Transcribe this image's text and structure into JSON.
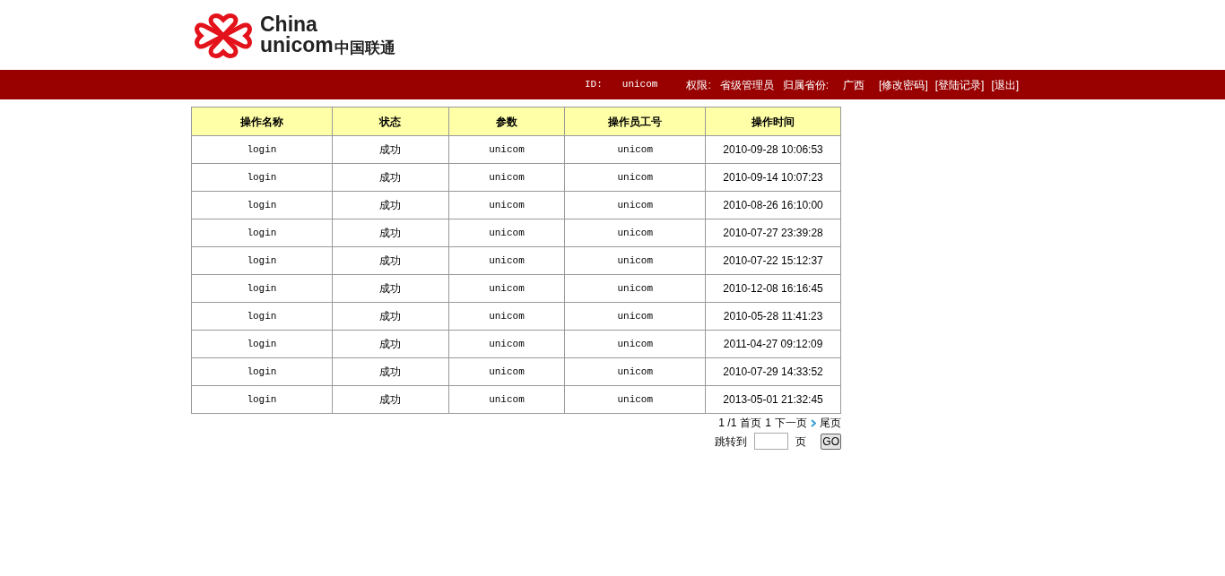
{
  "logo": {
    "line_1": "China",
    "line_2": "unicom",
    "line_3": "中国联通"
  },
  "topbar": {
    "id_label": "ID:",
    "id_value": "unicom",
    "role_label": "权限:",
    "role_value": "省级管理员",
    "province_label": "归属省份:",
    "province_value": "广西",
    "links": [
      "[修改密码]",
      "[登陆记录]",
      "[退出]"
    ]
  },
  "table": {
    "columns": [
      "操作名称",
      "状态",
      "参数",
      "操作员工号",
      "操作时间"
    ],
    "rows": [
      [
        "login",
        "成功",
        "unicom",
        "unicom",
        "2010-09-28 10:06:53"
      ],
      [
        "login",
        "成功",
        "unicom",
        "unicom",
        "2010-09-14 10:07:23"
      ],
      [
        "login",
        "成功",
        "unicom",
        "unicom",
        "2010-08-26 16:10:00"
      ],
      [
        "login",
        "成功",
        "unicom",
        "unicom",
        "2010-07-27 23:39:28"
      ],
      [
        "login",
        "成功",
        "unicom",
        "unicom",
        "2010-07-22 15:12:37"
      ],
      [
        "login",
        "成功",
        "unicom",
        "unicom",
        "2010-12-08 16:16:45"
      ],
      [
        "login",
        "成功",
        "unicom",
        "unicom",
        "2010-05-28 11:41:23"
      ],
      [
        "login",
        "成功",
        "unicom",
        "unicom",
        "2011-04-27 09:12:09"
      ],
      [
        "login",
        "成功",
        "unicom",
        "unicom",
        "2010-07-29 14:33:52"
      ],
      [
        "login",
        "成功",
        "unicom",
        "unicom",
        "2013-05-01 21:32:45"
      ]
    ]
  },
  "pagination": {
    "page_info": "1 /1",
    "first": "首页",
    "current": "1",
    "next": "下一页",
    "last": "尾页",
    "jump_label": "跳转到",
    "page_unit": "页",
    "go_button": "GO"
  }
}
